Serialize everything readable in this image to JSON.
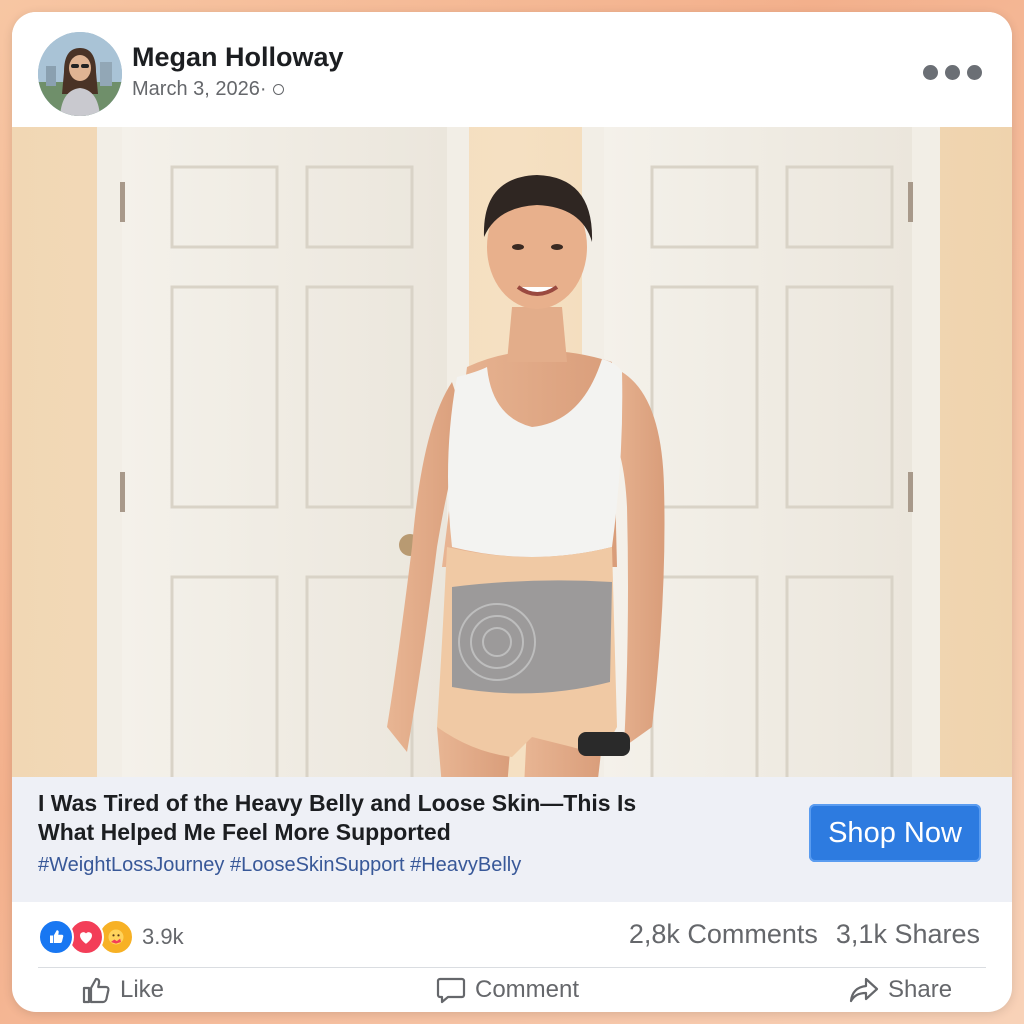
{
  "post": {
    "author": "Megan Holloway",
    "date": "March 3, 2026·",
    "menu_icon": "more-horizontal-icon",
    "headline_line1": "I Was Tired of the Heavy Belly and Loose Skin—This Is",
    "headline_line2": "What Helped Me Feel More Supported",
    "hashtags": "#WeightLossJourney #LooseSkinSupport #HeavyBelly",
    "cta_label": "Shop Now"
  },
  "stats": {
    "reactions": [
      "like",
      "love",
      "care"
    ],
    "reaction_count": "3.9k",
    "comments": "2,8k Comments",
    "shares": "3,1k Shares"
  },
  "actions": {
    "like": "Like",
    "comment": "Comment",
    "share": "Share"
  },
  "colors": {
    "accent_blue": "#2d7be0",
    "link_blue": "#385898",
    "like_blue": "#1877f2",
    "love_red": "#f33e58",
    "care_yellow": "#f7b125"
  }
}
